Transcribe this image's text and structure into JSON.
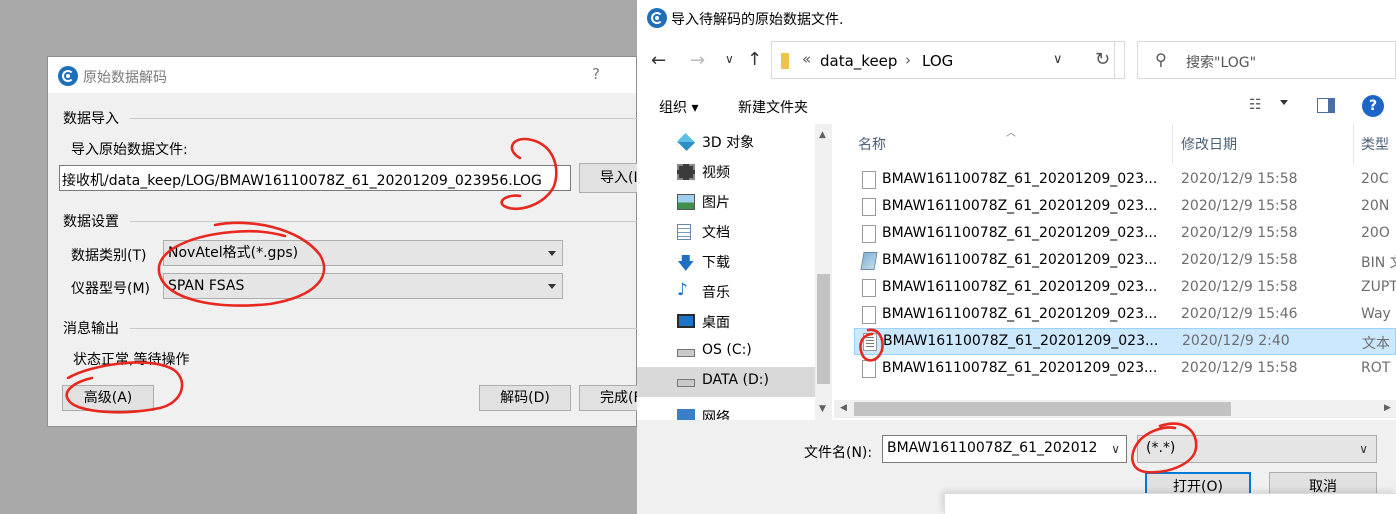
{
  "decode_dialog": {
    "title": "原始数据解码",
    "help": "?",
    "import_group": "数据导入",
    "import_label": "导入原始数据文件:",
    "path_value": "接收机/data_keep/LOG/BMAW16110078Z_61_20201209_023956.LOG",
    "import_button": "导入(I)",
    "settings_group": "数据设置",
    "data_type_label": "数据类别(T)",
    "data_type_value": "NovAtel格式(*.gps)",
    "device_label": "仪器型号(M)",
    "device_value": "SPAN FSAS",
    "output_group": "消息输出",
    "status_text": "状态正常,等待操作",
    "advanced_button": "高级(A)",
    "decode_button": "解码(D)",
    "done_button": "完成(F)"
  },
  "file_dialog": {
    "title": "导入待解码的原始数据文件.",
    "breadcrumb": [
      "data_keep",
      "LOG"
    ],
    "search_placeholder": "搜索\"LOG\"",
    "organize": "组织",
    "new_folder": "新建文件夹",
    "nav_items": [
      {
        "label": "3D 对象",
        "icon": "cube-icon"
      },
      {
        "label": "视频",
        "icon": "video-icon"
      },
      {
        "label": "图片",
        "icon": "picture-icon"
      },
      {
        "label": "文档",
        "icon": "document-icon"
      },
      {
        "label": "下载",
        "icon": "download-icon"
      },
      {
        "label": "音乐",
        "icon": "music-icon"
      },
      {
        "label": "桌面",
        "icon": "desktop-icon"
      },
      {
        "label": "OS (C:)",
        "icon": "drive-icon"
      },
      {
        "label": "DATA (D:)",
        "icon": "drive-icon"
      },
      {
        "label": "网络",
        "icon": "network-icon"
      }
    ],
    "columns": {
      "name": "名称",
      "date": "修改日期",
      "type": "类型"
    },
    "files": [
      {
        "name": "BMAW16110078Z_61_20201209_023...",
        "date": "2020/12/9 15:58",
        "type": "20C",
        "icon": "file-icon"
      },
      {
        "name": "BMAW16110078Z_61_20201209_023...",
        "date": "2020/12/9 15:58",
        "type": "20N",
        "icon": "file-icon"
      },
      {
        "name": "BMAW16110078Z_61_20201209_023...",
        "date": "2020/12/9 15:58",
        "type": "20O",
        "icon": "file-icon"
      },
      {
        "name": "BMAW16110078Z_61_20201209_023...",
        "date": "2020/12/9 15:58",
        "type": "BIN 文",
        "icon": "bin-file-icon"
      },
      {
        "name": "BMAW16110078Z_61_20201209_023...",
        "date": "2020/12/9 15:58",
        "type": "ZUPT",
        "icon": "file-icon"
      },
      {
        "name": "BMAW16110078Z_61_20201209_023...",
        "date": "2020/12/9 15:46",
        "type": "Way",
        "icon": "file-icon"
      },
      {
        "name": "BMAW16110078Z_61_20201209_023...",
        "date": "2020/12/9 2:40",
        "type": "文本",
        "icon": "text-file-icon",
        "selected": true
      },
      {
        "name": "BMAW16110078Z_61_20201209_023...",
        "date": "2020/12/9 15:58",
        "type": "ROT",
        "icon": "file-icon"
      }
    ],
    "filename_label": "文件名(N):",
    "filename_value": "BMAW16110078Z_61_202012",
    "filetype_value": "(*.*)",
    "open_button": "打开(O)",
    "cancel_button": "取消"
  },
  "colors": {
    "selection": "#cce8ff",
    "accent": "#0078d7",
    "annotation": "#e8271e"
  }
}
